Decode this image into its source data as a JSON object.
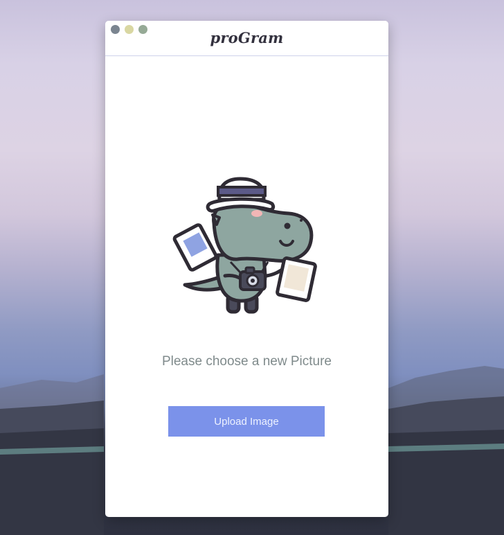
{
  "window": {
    "title": "proGram"
  },
  "main": {
    "prompt": "Please choose a new Picture",
    "upload_button_label": "Upload Image"
  },
  "icons": {
    "close": "close-dot-icon",
    "minimize": "minimize-dot-icon",
    "zoom": "zoom-dot-icon",
    "mascot": "dinosaur-photographer-illustration"
  },
  "colors": {
    "button": "#7b92ea",
    "prompt_text": "#7f8a8b",
    "title_text": "#33313e",
    "dino_body": "#8ea6a0"
  }
}
